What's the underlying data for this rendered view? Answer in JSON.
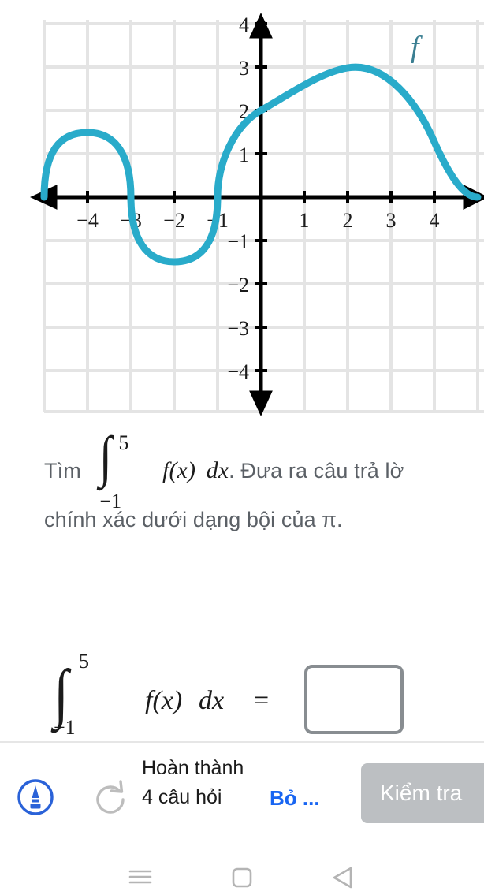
{
  "graph": {
    "function_label": "f",
    "curve_color": "#29abca",
    "axis_color": "#000000",
    "grid_color": "#e4e4e4",
    "x_tick_labels": [
      "−4",
      "−3",
      "−2",
      "−1",
      "1",
      "2",
      "3",
      "4"
    ],
    "y_tick_labels": [
      "4",
      "3",
      "2",
      "1",
      "−1",
      "−2",
      "−3",
      "−4"
    ]
  },
  "chart_data": {
    "type": "line",
    "title": "",
    "xlabel": "",
    "ylabel": "",
    "xlim": [
      -5,
      5
    ],
    "ylim": [
      -4.6,
      4.3
    ],
    "grid": true,
    "legend": [
      "f"
    ],
    "series": [
      {
        "name": "f",
        "description": "Piecewise curve: semicircular bump above axis on [-5,-3], semicircular dip below axis on [-3,-1], large semicircle above axis on [-1,5] peaking at y=3 near x=2",
        "key_points": [
          {
            "x": -5,
            "y": 0
          },
          {
            "x": -4,
            "y": 1
          },
          {
            "x": -3,
            "y": 0
          },
          {
            "x": -2,
            "y": -1
          },
          {
            "x": -1,
            "y": 0
          },
          {
            "x": 0,
            "y": 2
          },
          {
            "x": 2,
            "y": 3
          },
          {
            "x": 3,
            "y": 2.85
          },
          {
            "x": 4,
            "y": 2.2
          },
          {
            "x": 5,
            "y": 0
          }
        ]
      }
    ],
    "annotations": [
      {
        "text": "f",
        "x": 3.2,
        "y": 3.6
      }
    ]
  },
  "question": {
    "line1_prefix": "Tìm",
    "integral_lower": "−1",
    "integral_upper": "5",
    "integrand": "f(x)",
    "differential": "dx",
    "line1_suffix": ". Đưa ra câu trả lờ",
    "line2": "chính xác dưới dạng bội của π."
  },
  "answer": {
    "integral_lower": "−1",
    "integral_upper": "5",
    "integrand": "f(x)",
    "differential": "dx",
    "equals": "=",
    "value": "",
    "placeholder": ""
  },
  "toolbar": {
    "pen_icon": "pen-tip-in-circle-icon",
    "redo_icon": "redo-circular-arrow-icon",
    "progress_label": "Hoàn thành 4 câu hỏi",
    "skip_label": "Bỏ ...",
    "check_label": "Kiểm tra",
    "skip_color": "#1865f2",
    "check_bg": "#bcbfc2"
  },
  "navbar": {
    "recents_icon": "hamburger-recents-icon",
    "home_icon": "home-square-icon",
    "back_icon": "back-triangle-icon"
  }
}
